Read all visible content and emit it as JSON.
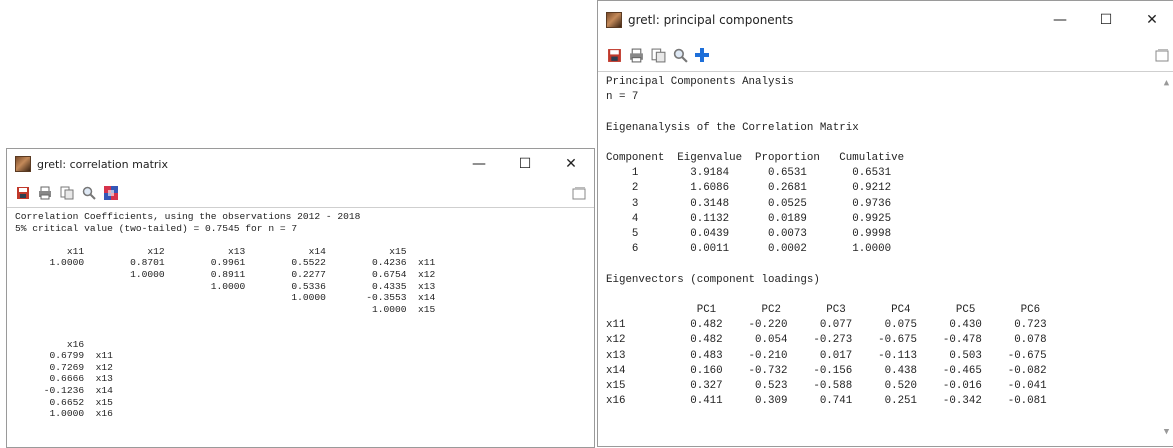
{
  "corr_window": {
    "title": "gretl: correlation matrix",
    "controls": {
      "minimize": "—",
      "maximize": "☐",
      "close": "✕"
    },
    "content": "Correlation Coefficients, using the observations 2012 - 2018\n5% critical value (two-tailed) = 0.7545 for n = 7\n\n         x11           x12           x13           x14           x15\n      1.0000        0.8701        0.9961        0.5522        0.4236  x11\n                    1.0000        0.8911        0.2277        0.6754  x12\n                                  1.0000        0.5336        0.4335  x13\n                                                1.0000       -0.3553  x14\n                                                              1.0000  x15\n\n\n         x16\n      0.6799  x11\n      0.7269  x12\n      0.6666  x13\n     -0.1236  x14\n      0.6652  x15\n      1.0000  x16"
  },
  "pca_window": {
    "title": "gretl: principal components",
    "controls": {
      "minimize": "—",
      "maximize": "☐",
      "close": "✕"
    },
    "content": "Principal Components Analysis\nn = 7\n\nEigenanalysis of the Correlation Matrix\n\nComponent  Eigenvalue  Proportion   Cumulative\n    1        3.9184      0.6531       0.6531\n    2        1.6086      0.2681       0.9212\n    3        0.3148      0.0525       0.9736\n    4        0.1132      0.0189       0.9925\n    5        0.0439      0.0073       0.9998\n    6        0.0011      0.0002       1.0000\n\nEigenvectors (component loadings)\n\n              PC1       PC2       PC3       PC4       PC5       PC6\nx11          0.482    -0.220     0.077     0.075     0.430     0.723\nx12          0.482     0.054    -0.273    -0.675    -0.478     0.078\nx13          0.483    -0.210     0.017    -0.113     0.503    -0.675\nx14          0.160    -0.732    -0.156     0.438    -0.465    -0.082\nx15          0.327     0.523    -0.588     0.520    -0.016    -0.041\nx16          0.411     0.309     0.741     0.251    -0.342    -0.081"
  },
  "toolbar_icons": [
    "save-icon",
    "print-icon",
    "copy-icon",
    "find-icon",
    "plot-icon",
    "add-icon",
    "window-list-icon"
  ],
  "colors": {
    "save_icon": "#c0392b",
    "add_icon": "#1e6fd9",
    "window_border": "#9a9a9a"
  }
}
